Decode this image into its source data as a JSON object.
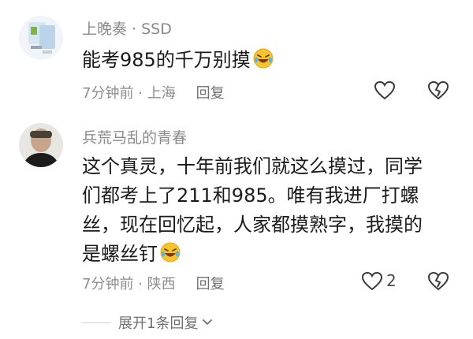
{
  "comments": [
    {
      "username": "上晚奏 · SSD",
      "text": "能考985的千万别摸",
      "time_location": "7分钟前 · 上海",
      "reply_label": "回复",
      "like_count": ""
    },
    {
      "username": "兵荒马乱的青春",
      "lines": [
        "这个真灵，十年前我们就这么摸过，同学",
        "们都考上了211和985。唯有我进厂打螺",
        "丝，现在回忆起，人家都摸熟字，我摸的",
        "是螺丝钉"
      ],
      "time_location": "7分钟前 · 陕西",
      "reply_label": "回复",
      "like_count": "2"
    }
  ],
  "expand_replies": "展开1条回复",
  "icons": {
    "like": "heart-outline-icon",
    "dislike": "broken-heart-icon",
    "emoji": "laughing-tears-emoji",
    "expand": "chevron-down-icon"
  },
  "colors": {
    "text": "#1a1a1a",
    "meta": "#8e8e8e",
    "emoji_yellow": "#f7c32e"
  }
}
